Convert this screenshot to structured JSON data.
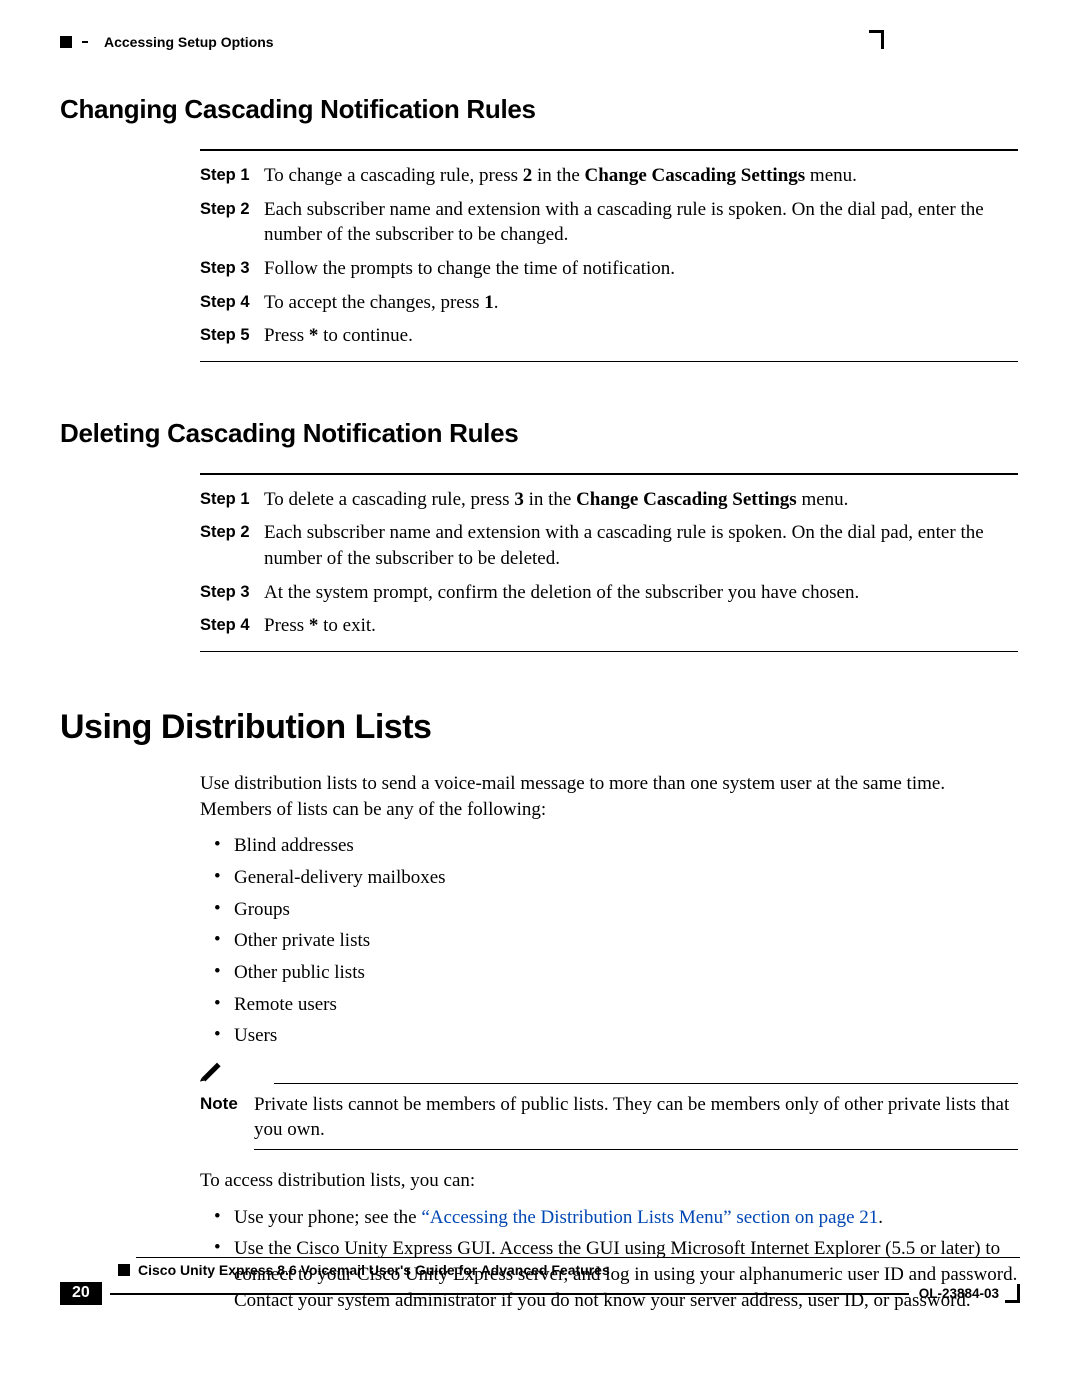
{
  "header": {
    "breadcrumb": "Accessing Setup Options"
  },
  "section1": {
    "title": "Changing Cascading Notification Rules",
    "steps": [
      {
        "n": "Step 1",
        "pre": "To change a cascading rule, press ",
        "key": "2",
        "mid": " in the ",
        "menu": "Change Cascading Settings",
        "post": " menu."
      },
      {
        "n": "Step 2",
        "text": "Each subscriber name and extension with a cascading rule is spoken. On the dial pad, enter the number of the subscriber to be changed."
      },
      {
        "n": "Step 3",
        "text": "Follow the prompts to change the time of notification."
      },
      {
        "n": "Step 4",
        "pre": "To accept the changes, press ",
        "key": "1",
        "post": "."
      },
      {
        "n": "Step 5",
        "pre": "Press ",
        "key": "*",
        "post": " to continue."
      }
    ]
  },
  "section2": {
    "title": "Deleting Cascading Notification Rules",
    "steps": [
      {
        "n": "Step 1",
        "pre": "To delete a cascading rule, press ",
        "key": "3",
        "mid": " in the ",
        "menu": "Change Cascading Settings",
        "post": " menu."
      },
      {
        "n": "Step 2",
        "text": "Each subscriber name and extension with a cascading rule is spoken. On the dial pad, enter the number of the subscriber to be deleted."
      },
      {
        "n": "Step 3",
        "text": "At the system prompt, confirm the deletion of the subscriber you have chosen."
      },
      {
        "n": "Step 4",
        "pre": "Press ",
        "key": "*",
        "post": " to exit."
      }
    ]
  },
  "section3": {
    "title": "Using Distribution Lists",
    "intro": "Use distribution lists to send a voice-mail message to more than one system user at the same time. Members of lists can be any of the following:",
    "items": [
      "Blind addresses",
      "General-delivery mailboxes",
      "Groups",
      "Other private lists",
      "Other public lists",
      "Remote users",
      "Users"
    ],
    "note_label": "Note",
    "note": "Private lists cannot be members of public lists. They can be members only of other private lists that you own.",
    "access_intro": "To access distribution lists, you can:",
    "access1_pre": "Use your phone; see the ",
    "access1_link": "“Accessing the Distribution Lists Menu” section on page 21",
    "access1_post": ".",
    "access2": "Use the Cisco Unity Express GUI. Access the GUI using Microsoft Internet Explorer (5.5 or later) to connect to your Cisco Unity Express server, and log in using your alphanumeric user ID and password. Contact your system administrator if you do not know your server address, user ID, or password."
  },
  "footer": {
    "title": "Cisco Unity Express 8.6 Voicemail User's Guide for Advanced Features",
    "page": "20",
    "docid": "OL-23884-03"
  }
}
